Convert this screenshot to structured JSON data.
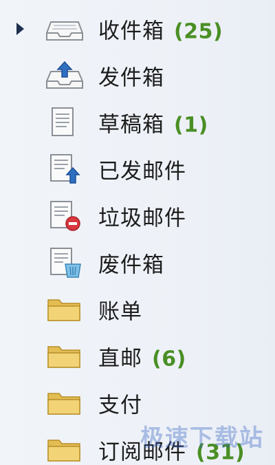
{
  "folders": [
    {
      "label": "收件箱",
      "count": "(25)",
      "icon": "inbox-icon",
      "selected": true
    },
    {
      "label": "发件箱",
      "count": "",
      "icon": "outbox-icon",
      "selected": false
    },
    {
      "label": "草稿箱",
      "count": "(1)",
      "icon": "drafts-icon",
      "selected": false
    },
    {
      "label": "已发邮件",
      "count": "",
      "icon": "sent-mail-icon",
      "selected": false
    },
    {
      "label": "垃圾邮件",
      "count": "",
      "icon": "spam-icon",
      "selected": false
    },
    {
      "label": "废件箱",
      "count": "",
      "icon": "trash-icon",
      "selected": false
    },
    {
      "label": "账单",
      "count": "",
      "icon": "folder-icon",
      "selected": false
    },
    {
      "label": "直邮",
      "count": "(6)",
      "icon": "folder-icon",
      "selected": false
    },
    {
      "label": "支付",
      "count": "",
      "icon": "folder-icon",
      "selected": false
    },
    {
      "label": "订阅邮件",
      "count": "(31)",
      "icon": "folder-icon",
      "selected": false
    }
  ],
  "watermark": "极速下载站",
  "colors": {
    "count": "#4a8f25",
    "pointer": "#1f2f4f",
    "folder": "#e8c965",
    "background": "#eef2f7"
  }
}
